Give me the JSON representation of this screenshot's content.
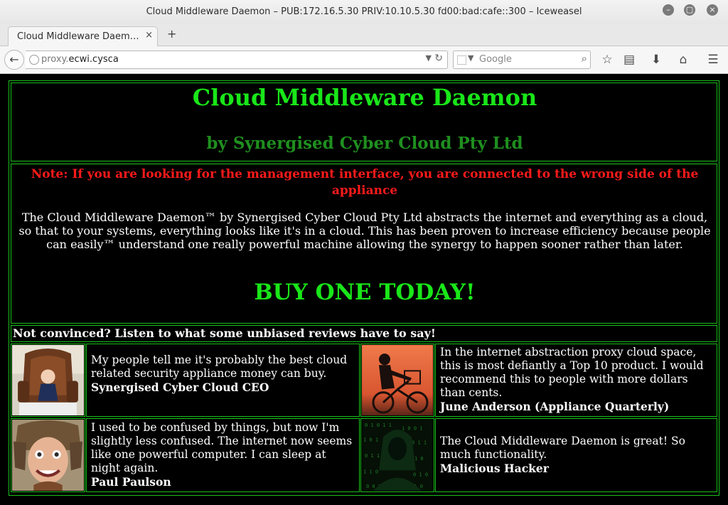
{
  "browser": {
    "window_title": "Cloud Middleware Daemon – PUB:172.16.5.30 PRIV:10.10.5.30 fd00:bad:cafe::300 – Iceweasel",
    "tab_title": "Cloud Middleware Daem…",
    "tab_close": "×",
    "new_tab": "+",
    "url_host": "proxy.",
    "url_domain": "ecwi.cysca",
    "search_placeholder": "Google",
    "window_buttons": [
      "minimize-icon",
      "maximize-icon",
      "close-icon"
    ],
    "toolbar_icons": [
      "bookmark-star-icon",
      "reading-list-icon",
      "download-icon",
      "home-icon",
      "menu-icon"
    ]
  },
  "page": {
    "heading": "Cloud Middleware Daemon",
    "subheading": "by Synergised Cyber Cloud Pty Ltd",
    "note": "Note: If you are looking for the management interface, you are connected to the wrong side of the appliance",
    "description": "The Cloud Middleware Daemon™ by Synergised Cyber Cloud Pty Ltd abstracts the internet and everything as a cloud, so that to your systems, everything looks like it's in a cloud. This has been proven to increase efficiency because people can easily™ understand one really powerful machine allowing the synergy to happen sooner rather than later.",
    "cta": "BUY ONE TODAY!",
    "reviews_intro": "Not convinced? Listen to what some unbiased reviews have to say!",
    "reviews": [
      {
        "quote": "My people tell me it's probably the best cloud related security appliance money can buy.",
        "author": "Synergised Cyber Cloud CEO",
        "photo": "baby-in-armchair"
      },
      {
        "quote": "In the internet abstraction proxy cloud space, this is most defiantly a Top 10 product. I would recommend this to people with more dollars than cents.",
        "author": "June Anderson (Appliance Quarterly)",
        "photo": "cyclist-silhouette-sunset"
      },
      {
        "quote": "I used to be confused by things, but now I'm slightly less confused. The internet now seems like one powerful computer. I can sleep at night again.",
        "author": "Paul Paulson",
        "photo": "man-in-fur-hat"
      },
      {
        "quote": "The Cloud Middleware Daemon is great! So much functionality.",
        "author": "Malicious Hacker",
        "photo": "hooded-hacker-matrix"
      }
    ]
  },
  "colors": {
    "accent_green": "#19e619",
    "dark_green": "#1f8f1f",
    "warning_red": "#ff1a1a",
    "border_green": "#19c219",
    "background": "#000000"
  }
}
